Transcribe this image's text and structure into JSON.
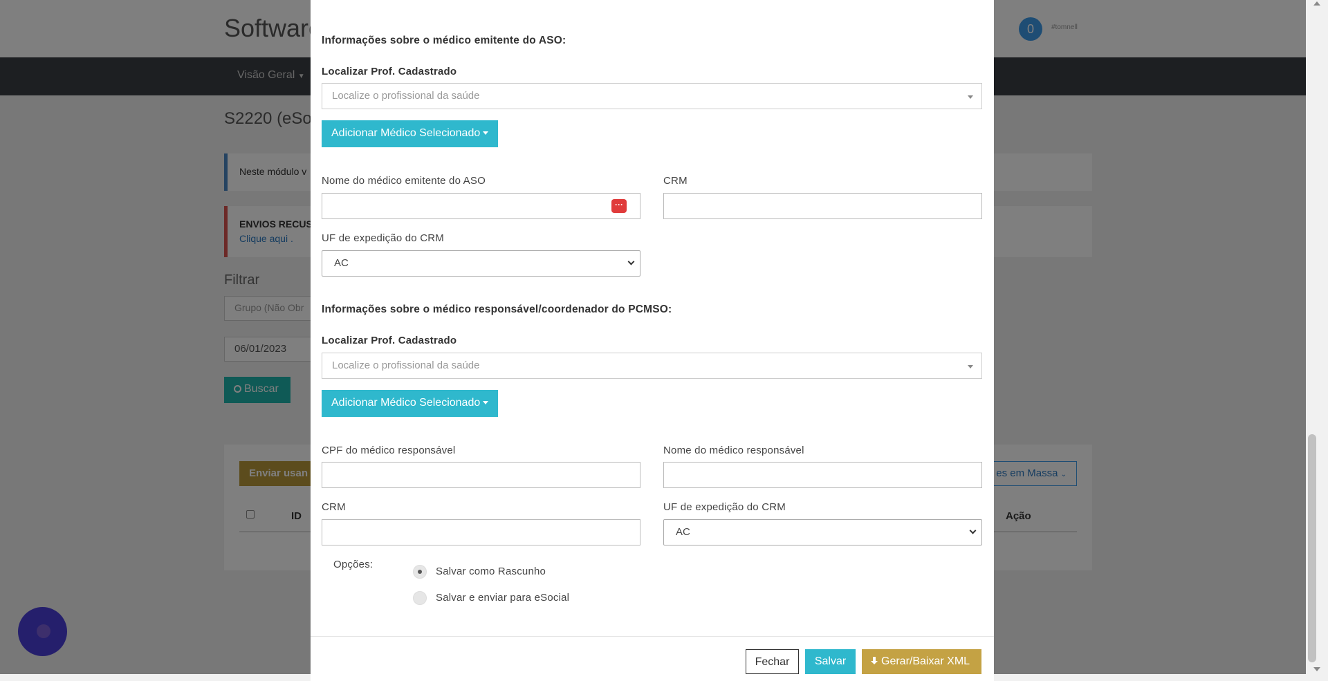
{
  "background": {
    "brand": "Software",
    "notification_count": "0",
    "user_label": "#tomnell",
    "nav_item": "Visão Geral",
    "page_title": "S2220 (eSo",
    "info_text": "Neste módulo v",
    "warning_title": "ENVIOS RECUS",
    "warning_link": "Clique aqui .",
    "filter_label": "Filtrar",
    "group_placeholder": "Grupo (Não Obr",
    "date_value": "06/01/2023",
    "search_button": "Buscar",
    "send_button": "Enviar usan",
    "bulk_actions_button": "es em Massa",
    "table_headers": {
      "id": "ID",
      "action": "Ação"
    }
  },
  "modal": {
    "section_issuer_title": "Informações sobre o médico emitente do ASO:",
    "locate_label_1": "Localizar Prof. Cadastrado",
    "locate_placeholder_1": "Localize o profissional da saúde",
    "add_button_1": "Adicionar Médico Selecionado",
    "issuer_name_label": "Nome do médico emitente do ASO",
    "issuer_name_value": "",
    "issuer_crm_label": "CRM",
    "issuer_crm_value": "",
    "issuer_uf_label": "UF de expedição do CRM",
    "issuer_uf_value": "AC",
    "section_responsible_title": "Informações sobre o médico responsável/coordenador do PCMSO:",
    "locate_label_2": "Localizar Prof. Cadastrado",
    "locate_placeholder_2": "Localize o profissional da saúde",
    "add_button_2": "Adicionar Médico Selecionado",
    "resp_cpf_label": "CPF do médico responsável",
    "resp_cpf_value": "",
    "resp_name_label": "Nome do médico responsável",
    "resp_name_value": "",
    "resp_crm_label": "CRM",
    "resp_crm_value": "",
    "resp_uf_label": "UF de expedição do CRM",
    "resp_uf_value": "AC",
    "options_label": "Opções:",
    "option_draft": "Salvar como Rascunho",
    "option_send": "Salvar e enviar para eSocial",
    "selected_option": "Salvar como Rascunho",
    "close_button": "Fechar",
    "save_button": "Salvar",
    "xml_button": "Gerar/Baixar XML"
  },
  "colors": {
    "overlay": "rgba(0,0,0,0.5)",
    "primary_button": "#2fb8cd",
    "xml_button": "#c4a244",
    "nav_bar": "#3a3f45"
  }
}
